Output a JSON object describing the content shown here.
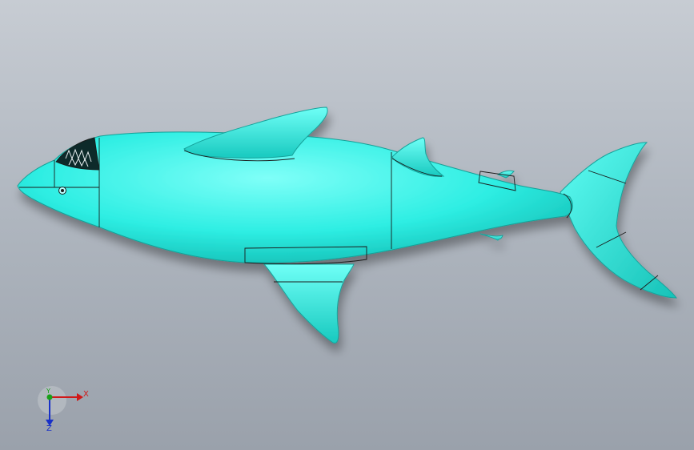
{
  "viewport": {
    "background_top": "#c7ccd3",
    "background_bottom": "#9aa1ab"
  },
  "model": {
    "body_color": "#33f0e6",
    "edge_color": "#1a1a1a"
  },
  "triad": {
    "x_label": "X",
    "y_label": "Y",
    "z_label": "Z",
    "x_color": "#d01818",
    "y_color": "#18a018",
    "z_color": "#1830c8"
  }
}
